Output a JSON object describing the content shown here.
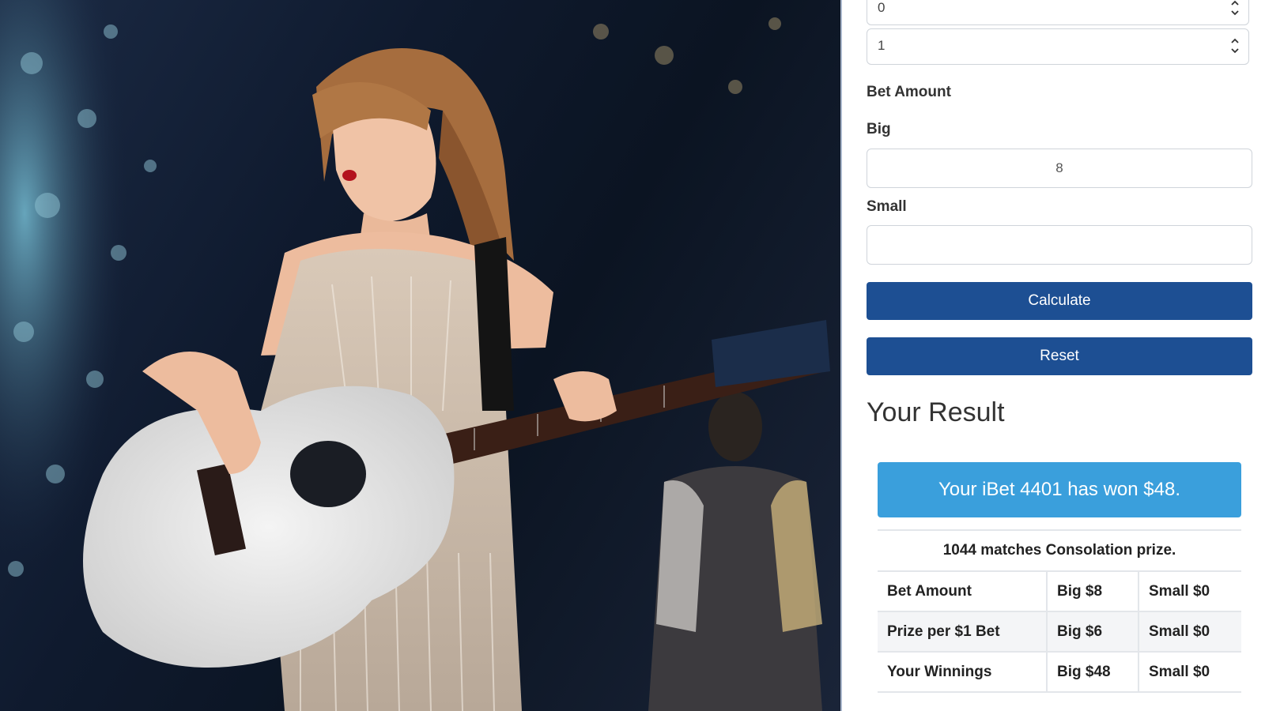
{
  "photo": {
    "description_icon": "concert-performer-with-glitter-guitar"
  },
  "form": {
    "select_1_value": "0",
    "select_2_value": "1",
    "bet_amount_label": "Bet Amount",
    "big_label": "Big",
    "big_value": "8",
    "small_label": "Small",
    "small_value": "",
    "calculate_label": "Calculate",
    "reset_label": "Reset"
  },
  "result": {
    "title": "Your Result",
    "banner": "Your iBet 4401 has won $48.",
    "note": "1044 matches Consolation prize.",
    "rows": [
      {
        "label": "Bet Amount",
        "big": "Big $8",
        "small": "Small $0"
      },
      {
        "label": "Prize per $1 Bet",
        "big": "Big $6",
        "small": "Small $0"
      },
      {
        "label": "Your Winnings",
        "big": "Big $48",
        "small": "Small $0"
      }
    ]
  },
  "colors": {
    "button_primary": "#1d4f93",
    "banner": "#3a9fdc"
  }
}
